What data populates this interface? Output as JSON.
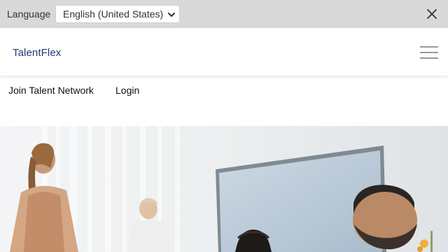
{
  "language_bar": {
    "label": "Language",
    "selected_language": "English (United States)",
    "chevron_icon": "chevron-down-icon",
    "close_icon": "close-icon"
  },
  "header": {
    "logo_text": "TalentFlex",
    "menu_icon": "hamburger-menu-icon"
  },
  "nav": {
    "join_label": "Join Talent Network",
    "login_label": "Login"
  },
  "colors": {
    "language_bar_bg": "#d9d9d9",
    "logo": "#1f3a6e",
    "menu_icon": "#9a9a9a"
  }
}
